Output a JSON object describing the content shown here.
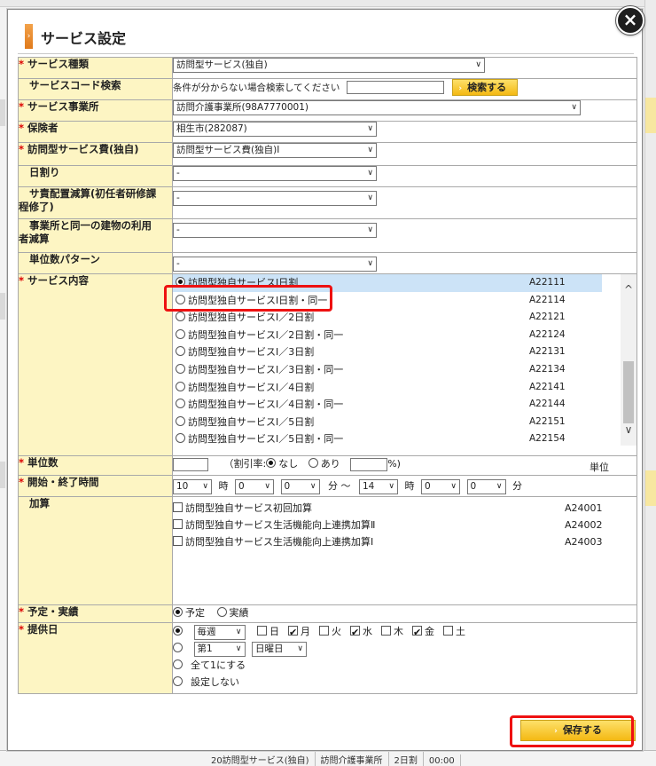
{
  "dialog": {
    "title": "サービス設定",
    "close_label": "×",
    "save_label": "保存する"
  },
  "colors": {
    "label_bg": "#fdf5c3",
    "required": "#dd0000",
    "button": "#f4b913",
    "highlight": "#ee1111"
  },
  "fields": {
    "service_type": {
      "label": "サービス種類",
      "value": "訪問型サービス(独自)"
    },
    "service_code_search": {
      "label": "サービスコード検索",
      "hint": "条件が分からない場合検索してください",
      "button": "検索する",
      "value": ""
    },
    "provider": {
      "label": "サービス事業所",
      "value": "訪問介護事業所(98A7770001)"
    },
    "insurer": {
      "label": "保険者",
      "value": "相生市(282087)"
    },
    "visit_fee": {
      "label": "訪問型サービス費(独自)",
      "value": "訪問型サービス費(独自)Ⅰ"
    },
    "daily": {
      "label": "日割り",
      "value": "-"
    },
    "sa_reduction": {
      "label_1": "サ責配置減算(初任者研修課",
      "label_2": "程修了)",
      "value": "-"
    },
    "same_building": {
      "label_1": "事業所と同一の建物の利用",
      "label_2": "者減算",
      "value": "-"
    },
    "unit_pattern": {
      "label": "単位数パターン",
      "value": "-"
    },
    "service_content": {
      "label": "サービス内容",
      "items": [
        {
          "name": "訪問型独自サービスⅠ日割",
          "code": "A22111",
          "selected": true
        },
        {
          "name": "訪問型独自サービスⅠ日割・同一",
          "code": "A22114",
          "selected": false
        },
        {
          "name": "訪問型独自サービスⅠ／2日割",
          "code": "A22121",
          "selected": false
        },
        {
          "name": "訪問型独自サービスⅠ／2日割・同一",
          "code": "A22124",
          "selected": false
        },
        {
          "name": "訪問型独自サービスⅠ／3日割",
          "code": "A22131",
          "selected": false
        },
        {
          "name": "訪問型独自サービスⅠ／3日割・同一",
          "code": "A22134",
          "selected": false
        },
        {
          "name": "訪問型独自サービスⅠ／4日割",
          "code": "A22141",
          "selected": false
        },
        {
          "name": "訪問型独自サービスⅠ／4日割・同一",
          "code": "A22144",
          "selected": false
        },
        {
          "name": "訪問型独自サービスⅠ／5日割",
          "code": "A22151",
          "selected": false
        },
        {
          "name": "訪問型独自サービスⅠ／5日割・同一",
          "code": "A22154",
          "selected": false
        }
      ]
    },
    "units": {
      "label": "単位数",
      "value": "",
      "discount_label": "（割引率:",
      "opt_none": "なし",
      "opt_yes": "あり",
      "percent_suffix": "%)",
      "unit_suffix": "単位"
    },
    "time": {
      "label": "開始・終了時間",
      "start_hour": "10",
      "start_min_tens": "0",
      "start_min_ones": "0",
      "end_hour": "14",
      "end_min_tens": "0",
      "end_min_ones": "0",
      "hour_unit": "時",
      "min_unit": "分",
      "tilde": "分 〜"
    },
    "additions": {
      "label": "加算",
      "items": [
        {
          "name": "訪問型独自サービス初回加算",
          "code": "A24001"
        },
        {
          "name": "訪問型独自サービス生活機能向上連携加算Ⅱ",
          "code": "A24002"
        },
        {
          "name": "訪問型独自サービス生活機能向上連携加算Ⅰ",
          "code": "A24003"
        }
      ]
    },
    "plan_actual": {
      "label": "予定・実績",
      "opt_plan": "予定",
      "opt_actual": "実績"
    },
    "provision_day": {
      "label": "提供日",
      "frequency": "毎週",
      "days": [
        {
          "name": "日",
          "checked": false
        },
        {
          "name": "月",
          "checked": true
        },
        {
          "name": "火",
          "checked": false
        },
        {
          "name": "水",
          "checked": true
        },
        {
          "name": "木",
          "checked": false
        },
        {
          "name": "金",
          "checked": true
        },
        {
          "name": "土",
          "checked": false
        }
      ],
      "nth": "第1",
      "weekday": "日曜日",
      "all_one": "全て1にする",
      "no_setting": "設定しない"
    }
  },
  "background": {
    "bottom_cells": [
      "20訪問型サービス(独自)",
      "訪問介護事業所",
      "2日割",
      "00:00"
    ]
  }
}
